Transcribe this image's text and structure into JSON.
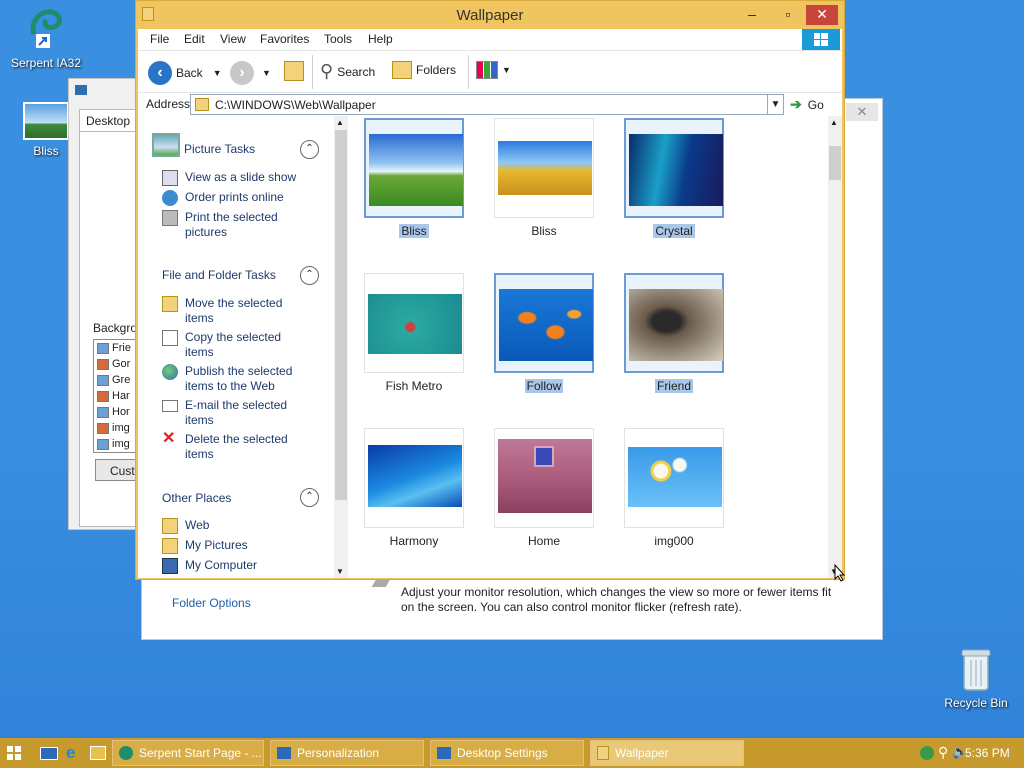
{
  "desktop": {
    "icons": [
      {
        "label": "Serpent IA32"
      },
      {
        "label": "Bliss"
      },
      {
        "label": "Recycle Bin"
      }
    ]
  },
  "display_props": {
    "tab_label": "Desktop",
    "background_label": "Backgrou",
    "list": [
      "Frie",
      "Gor",
      "Gre",
      "Har",
      "Hor",
      "img",
      "img"
    ],
    "customize_label": "Custo"
  },
  "personalization": {
    "folder_options": "Folder Options",
    "desc": "Adjust your monitor resolution, which changes the view so more or fewer items fit on the screen. You can also control monitor flicker (refresh rate)."
  },
  "explorer": {
    "title": "Wallpaper",
    "menu": [
      "File",
      "Edit",
      "View",
      "Favorites",
      "Tools",
      "Help"
    ],
    "toolbar": {
      "back": "Back",
      "search": "Search",
      "folders": "Folders"
    },
    "address_label": "Address",
    "address_value": "C:\\WINDOWS\\Web\\Wallpaper",
    "go_label": "Go",
    "picture_tasks": {
      "title": "Picture Tasks",
      "items": [
        "View as a slide show",
        "Order prints online",
        "Print the selected pictures"
      ]
    },
    "file_tasks": {
      "title": "File and Folder Tasks",
      "items": [
        "Move the selected items",
        "Copy the selected items",
        "Publish the selected items to the Web",
        "E-mail the selected items",
        "Delete the selected items"
      ]
    },
    "other_places": {
      "title": "Other Places",
      "items": [
        "Web",
        "My Pictures",
        "My Computer"
      ]
    },
    "files": [
      {
        "name": "Bliss",
        "selected": true
      },
      {
        "name": "Bliss",
        "selected": false
      },
      {
        "name": "Crystal",
        "selected": true
      },
      {
        "name": "Fish Metro",
        "selected": false
      },
      {
        "name": "Follow",
        "selected": true
      },
      {
        "name": "Friend",
        "selected": true
      },
      {
        "name": "Harmony",
        "selected": false
      },
      {
        "name": "Home",
        "selected": false
      },
      {
        "name": "img000",
        "selected": false
      }
    ]
  },
  "taskbar": {
    "tasks": [
      "Serpent Start Page - ...",
      "Personalization",
      "Desktop Settings",
      "Wallpaper"
    ],
    "time": "5:36 PM"
  }
}
